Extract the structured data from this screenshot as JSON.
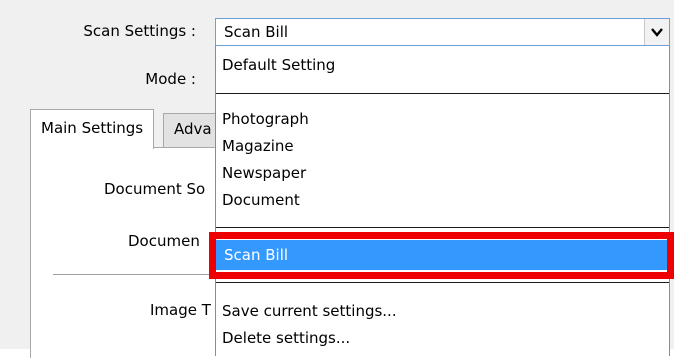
{
  "labels": {
    "scan_settings": "Scan Settings :",
    "mode": "Mode :",
    "document_source": "Document So",
    "document_size": "Documen",
    "image_type": "Image T"
  },
  "scan_settings_combo": {
    "value": "Scan Bill"
  },
  "tabs": [
    {
      "label": "Main Settings",
      "active": true
    },
    {
      "label": "Adva",
      "active": false
    }
  ],
  "dropdown": {
    "group1": [
      "Default Setting"
    ],
    "group2": [
      "Photograph",
      "Magazine",
      "Newspaper",
      "Document"
    ],
    "selected": "Scan Bill",
    "group3": [
      "Save current settings...",
      "Delete settings..."
    ]
  },
  "colors": {
    "selection": "#3399ff",
    "highlight_border": "#ee0000",
    "dialog_background": "#f0f0f0"
  }
}
